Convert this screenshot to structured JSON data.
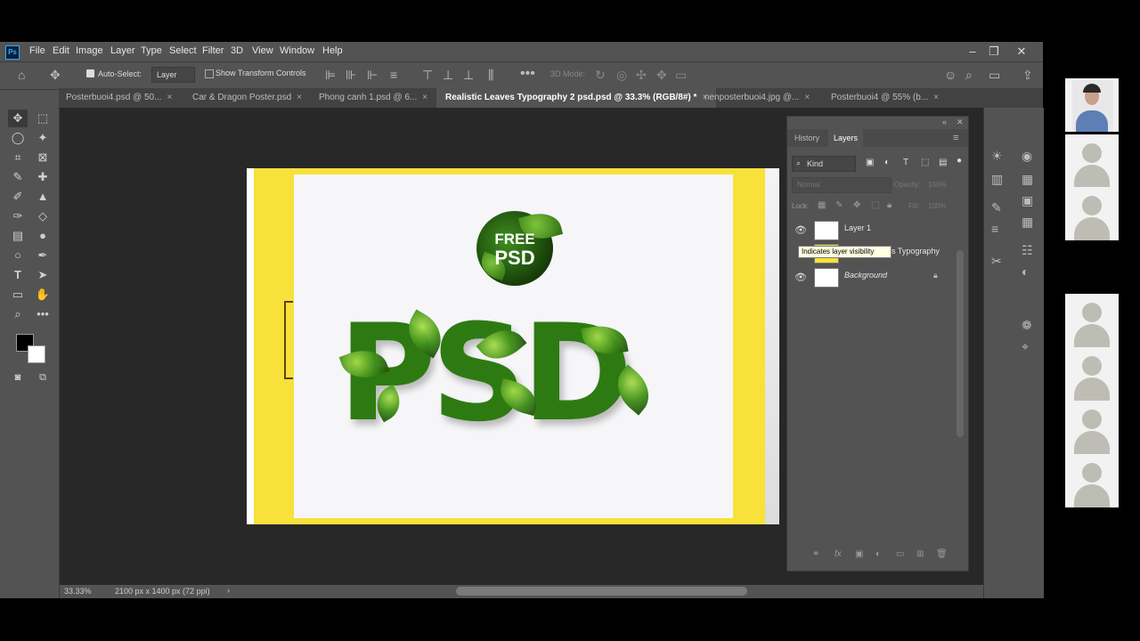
{
  "menu": {
    "items": [
      "File",
      "Edit",
      "Image",
      "Layer",
      "Type",
      "Select",
      "Filter",
      "3D",
      "View",
      "Window",
      "Help"
    ]
  },
  "app": {
    "logo": "Ps"
  },
  "options_bar": {
    "auto_select_label": "Auto-Select:",
    "auto_select_target": "Layer",
    "show_transform_label": "Show Transform Controls",
    "mode_3d_label": "3D Mode:"
  },
  "tabs": [
    {
      "label": "Posterbuoi4.psd @ 50..."
    },
    {
      "label": "Car & Dragon Poster.psd"
    },
    {
      "label": "Phong canh 1.psd @ 6..."
    },
    {
      "label": "Realistic Leaves Typography 2 psd.psd @ 33.3% (RGB/8#) *"
    },
    {
      "label": "nenposterbuoi4.jpg @..."
    },
    {
      "label": "Posterbuoi4 @ 55% (b..."
    }
  ],
  "artwork": {
    "badge_line1": "FREE",
    "badge_line2": "PSD",
    "headline": "PSD"
  },
  "panels": {
    "tabs": [
      "History",
      "Layers"
    ],
    "filter_kind": "Kind",
    "blend_mode": "Normal",
    "opacity_label": "Opacity:",
    "opacity_value": "100%",
    "lock_label": "Lock:",
    "fill_label": "Fill:",
    "fill_value": "100%",
    "layers": [
      {
        "name": "Layer 1"
      },
      {
        "name": "es Typography"
      },
      {
        "name": "Background"
      }
    ],
    "tooltip": "Indicates layer visibility"
  },
  "status": {
    "zoom": "33.33%",
    "doc_size": "2100 px x 1400 px (72 ppi)"
  },
  "colors": {
    "ps_bg": "#535353",
    "canvas_bg": "#282828",
    "poster_yellow": "#f7e13a",
    "leaf_green": "#2e7a12"
  }
}
